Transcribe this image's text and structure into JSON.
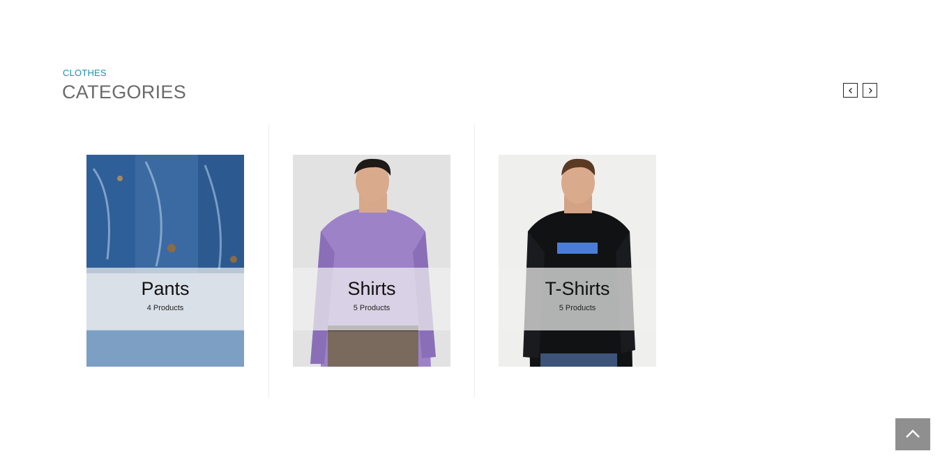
{
  "section": {
    "kicker": "CLOTHES",
    "title": "CATEGORIES"
  },
  "carousel": {
    "prev_icon": "chevron-left-icon",
    "next_icon": "chevron-right-icon"
  },
  "categories": [
    {
      "name": "Pants",
      "count": "4 Products",
      "image": "denim-jeans-photo"
    },
    {
      "name": "Shirts",
      "count": "5 Products",
      "image": "man-in-purple-shirt-photo"
    },
    {
      "name": "T-Shirts",
      "count": "5 Products",
      "image": "man-in-black-tshirt-photo"
    }
  ],
  "scroll_top": {
    "icon": "chevron-up-icon"
  },
  "colors": {
    "accent": "#1f8fb3",
    "title": "#6a6a6a",
    "scroll_button": "#8f8f8f"
  }
}
